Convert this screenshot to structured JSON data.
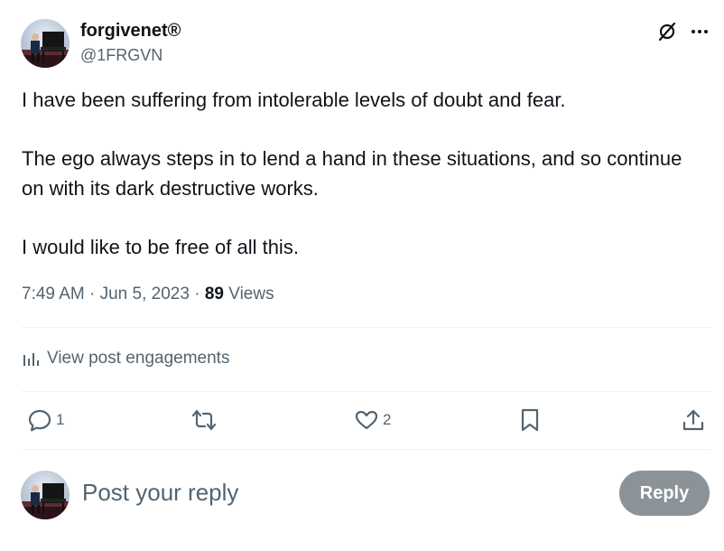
{
  "author": {
    "display_name": "forgivenet®",
    "handle": "@1FRGVN",
    "avatar_icon": "avatar-piano-player"
  },
  "header_actions": {
    "grok_icon": "grok-slash-icon",
    "more_icon": "more-dots-icon"
  },
  "post": {
    "paragraphs": [
      "I have been suffering from intolerable levels of doubt and fear.",
      "The ego always steps in to lend a hand in these situations, and so continue on with its dark destructive works.",
      "I would like to be free of all this."
    ],
    "time": "7:49 AM",
    "separator": "·",
    "date": "Jun 5, 2023",
    "views_count": "89",
    "views_label": "Views"
  },
  "engagements": {
    "label": "View post engagements",
    "icon": "analytics-bars-icon"
  },
  "actions": {
    "reply_count": "1",
    "repost_count": "",
    "like_count": "2"
  },
  "composer": {
    "placeholder": "Post your reply",
    "button_label": "Reply"
  },
  "colors": {
    "text_primary": "#0f1419",
    "text_secondary": "#536471",
    "divider": "#eff3f4",
    "reply_button_disabled": "#8b9398"
  }
}
